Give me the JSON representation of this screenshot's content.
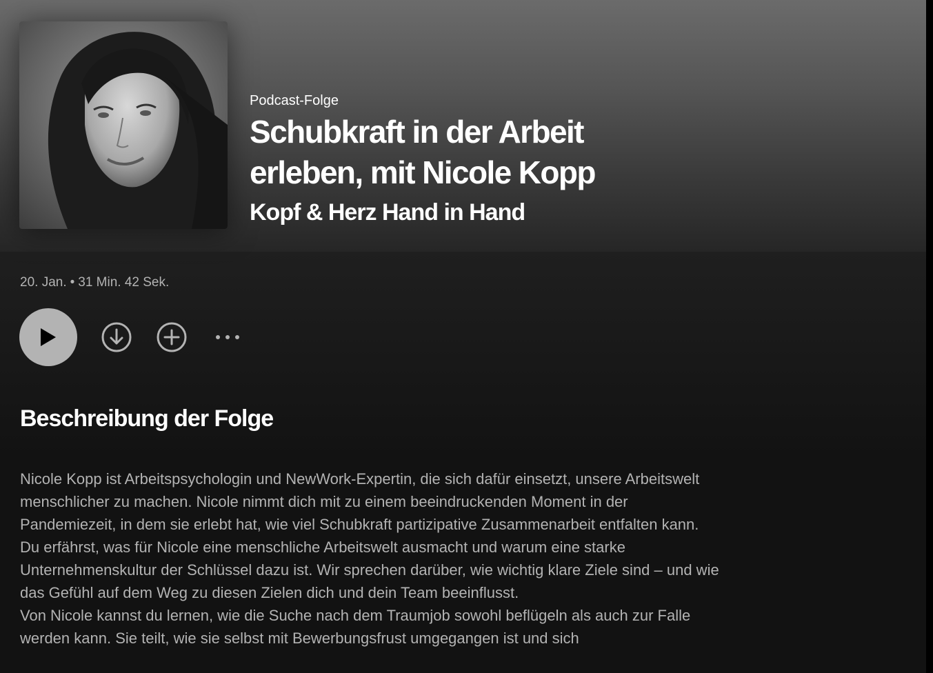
{
  "episode": {
    "kind_label": "Podcast-Folge",
    "title": "Schubkraft in der Arbeit erleben, mit Nicole Kopp",
    "show_name": "Kopf & Herz Hand in Hand",
    "date": "20. Jan.",
    "separator": "•",
    "duration": "31 Min. 42 Sek.",
    "cover_icon": "portrait-photo"
  },
  "controls": {
    "play_icon": "play-icon",
    "download_icon": "download-icon",
    "add_icon": "add-icon",
    "more_icon": "more-options-icon"
  },
  "description": {
    "heading": "Beschreibung der Folge",
    "paragraphs": [
      "Nicole Kopp ist Arbeitspsychologin und NewWork-Expertin, die sich dafür einsetzt, unsere Arbeitswelt menschlicher zu machen. Nicole nimmt dich mit zu einem beeindruckenden Moment in der Pandemiezeit, in dem sie erlebt hat, wie viel Schubkraft partizipative Zusammenarbeit entfalten kann.",
      "Du erfährst, was für Nicole eine menschliche Arbeitswelt ausmacht und warum eine starke Unternehmenskultur der Schlüssel dazu ist. Wir sprechen darüber, wie wichtig klare Ziele sind – und wie das Gefühl auf dem Weg zu diesen Zielen dich und dein Team beeinflusst.",
      "Von Nicole kannst du lernen, wie die Suche nach dem Traumjob sowohl beflügeln als auch zur Falle werden kann. Sie teilt, wie sie selbst mit Bewerbungsfrust umgegangen ist und sich"
    ]
  },
  "colors": {
    "background": "#121212",
    "hero_top": "#6b6b6b",
    "text_primary": "#ffffff",
    "text_secondary": "#b3b3b3",
    "play_button": "#b3b3b3"
  }
}
